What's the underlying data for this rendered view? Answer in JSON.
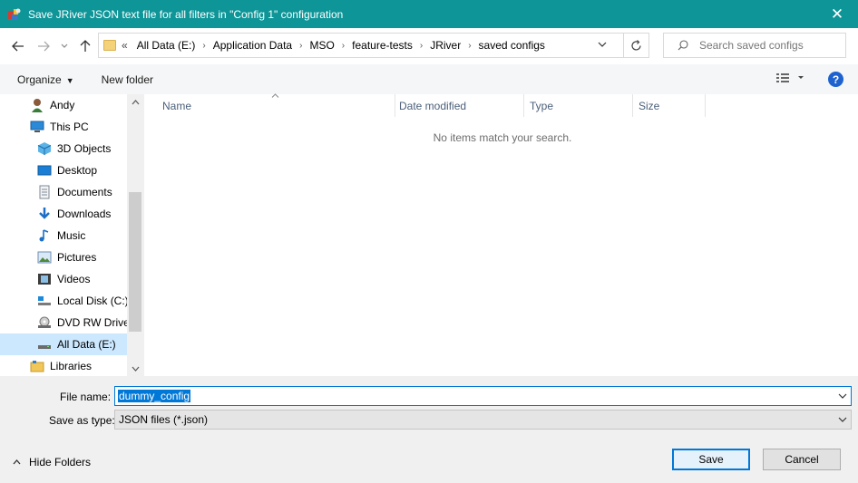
{
  "window": {
    "title": "Save JRiver JSON text file for all filters in \"Config 1\" configuration",
    "close_glyph": "✕",
    "accent": "#0e9598"
  },
  "address": {
    "overflow": "«",
    "crumbs": [
      "All Data (E:)",
      "Application Data",
      "MSO",
      "feature-tests",
      "JRiver",
      "saved configs"
    ],
    "separator": "›"
  },
  "search": {
    "placeholder": "Search saved configs"
  },
  "toolbar": {
    "organize": "Organize",
    "new_folder": "New folder",
    "help": "?"
  },
  "nav": {
    "items": [
      {
        "label": "Andy",
        "icon": "user-icon"
      },
      {
        "label": "This PC",
        "icon": "computer-icon"
      },
      {
        "label": "3D Objects",
        "icon": "cube-icon"
      },
      {
        "label": "Desktop",
        "icon": "desktop-icon"
      },
      {
        "label": "Documents",
        "icon": "document-icon"
      },
      {
        "label": "Downloads",
        "icon": "download-icon"
      },
      {
        "label": "Music",
        "icon": "music-icon"
      },
      {
        "label": "Pictures",
        "icon": "picture-icon"
      },
      {
        "label": "Videos",
        "icon": "video-icon"
      },
      {
        "label": "Local Disk (C:)",
        "icon": "drive-icon"
      },
      {
        "label": "DVD RW Drive",
        "icon": "dvd-icon"
      },
      {
        "label": "All Data (E:)",
        "icon": "drive-icon"
      },
      {
        "label": "Libraries",
        "icon": "library-icon"
      }
    ],
    "selected": "All Data (E:)"
  },
  "columns": [
    "Name",
    "Date modified",
    "Type",
    "Size"
  ],
  "empty_message": "No items match your search.",
  "form": {
    "file_name_label": "File name:",
    "file_name_value": "dummy_config",
    "save_type_label": "Save as type:",
    "save_type_value": "JSON files (*.json)"
  },
  "footer": {
    "hide_folders": "Hide Folders",
    "save": "Save",
    "cancel": "Cancel"
  }
}
